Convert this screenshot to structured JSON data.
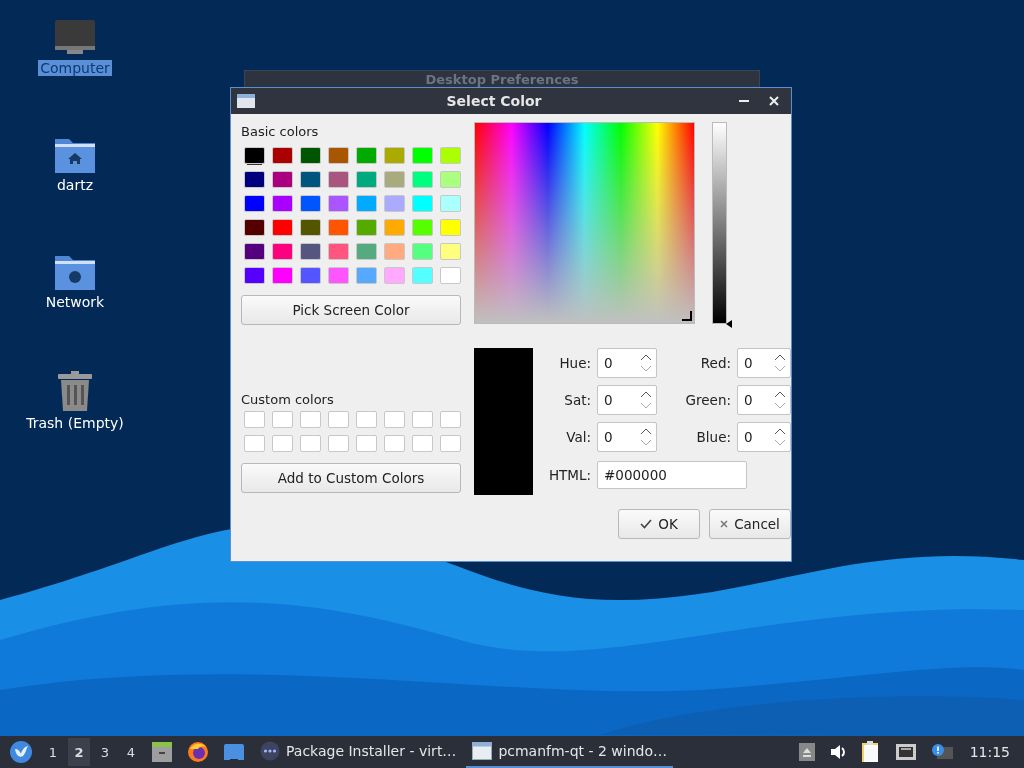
{
  "desktop_icons": [
    {
      "kind": "computer",
      "label": "Computer",
      "selected": true
    },
    {
      "kind": "home",
      "label": "dartz",
      "selected": false
    },
    {
      "kind": "network",
      "label": "Network",
      "selected": false
    },
    {
      "kind": "trash",
      "label": "Trash (Empty)",
      "selected": false
    }
  ],
  "background_window": {
    "title": "Desktop Preferences"
  },
  "dialog": {
    "title": "Select Color",
    "basic_colors_label": "Basic colors",
    "basic_colors": [
      {
        "color": "#000000",
        "selected": true
      },
      {
        "color": "#aa0000",
        "selected": false
      },
      {
        "color": "#005500",
        "selected": false
      },
      {
        "color": "#aa5500",
        "selected": false
      },
      {
        "color": "#00aa00",
        "selected": false
      },
      {
        "color": "#aaaa00",
        "selected": false
      },
      {
        "color": "#00ff00",
        "selected": false
      },
      {
        "color": "#aaff00",
        "selected": false
      },
      {
        "color": "#00007f",
        "selected": false
      },
      {
        "color": "#aa007f",
        "selected": false
      },
      {
        "color": "#00557f",
        "selected": false
      },
      {
        "color": "#aa557f",
        "selected": false
      },
      {
        "color": "#00aa7f",
        "selected": false
      },
      {
        "color": "#aaaa7f",
        "selected": false
      },
      {
        "color": "#00ff7f",
        "selected": false
      },
      {
        "color": "#aaff7f",
        "selected": false
      },
      {
        "color": "#0000ff",
        "selected": false
      },
      {
        "color": "#aa00ff",
        "selected": false
      },
      {
        "color": "#0055ff",
        "selected": false
      },
      {
        "color": "#aa55ff",
        "selected": false
      },
      {
        "color": "#00aaff",
        "selected": false
      },
      {
        "color": "#aaaaff",
        "selected": false
      },
      {
        "color": "#00ffff",
        "selected": false
      },
      {
        "color": "#aaffff",
        "selected": false
      },
      {
        "color": "#550000",
        "selected": false
      },
      {
        "color": "#ff0000",
        "selected": false
      },
      {
        "color": "#555500",
        "selected": false
      },
      {
        "color": "#ff5500",
        "selected": false
      },
      {
        "color": "#55aa00",
        "selected": false
      },
      {
        "color": "#ffaa00",
        "selected": false
      },
      {
        "color": "#55ff00",
        "selected": false
      },
      {
        "color": "#ffff00",
        "selected": false
      },
      {
        "color": "#55007f",
        "selected": false
      },
      {
        "color": "#ff007f",
        "selected": false
      },
      {
        "color": "#55557f",
        "selected": false
      },
      {
        "color": "#ff557f",
        "selected": false
      },
      {
        "color": "#55aa7f",
        "selected": false
      },
      {
        "color": "#ffaa7f",
        "selected": false
      },
      {
        "color": "#55ff7f",
        "selected": false
      },
      {
        "color": "#ffff7f",
        "selected": false
      },
      {
        "color": "#5500ff",
        "selected": false
      },
      {
        "color": "#ff00ff",
        "selected": false
      },
      {
        "color": "#5555ff",
        "selected": false
      },
      {
        "color": "#ff55ff",
        "selected": false
      },
      {
        "color": "#55aaff",
        "selected": false
      },
      {
        "color": "#ffaaff",
        "selected": false
      },
      {
        "color": "#55ffff",
        "selected": false
      },
      {
        "color": "#ffffff",
        "selected": false
      }
    ],
    "pick_button": "Pick Screen Color",
    "custom_colors_label": "Custom colors",
    "custom_colors": [
      {
        "color": "#ffffff"
      },
      {
        "color": "#ffffff"
      },
      {
        "color": "#ffffff"
      },
      {
        "color": "#ffffff"
      },
      {
        "color": "#ffffff"
      },
      {
        "color": "#ffffff"
      },
      {
        "color": "#ffffff"
      },
      {
        "color": "#ffffff"
      },
      {
        "color": "#ffffff"
      },
      {
        "color": "#ffffff"
      },
      {
        "color": "#ffffff"
      },
      {
        "color": "#ffffff"
      },
      {
        "color": "#ffffff"
      },
      {
        "color": "#ffffff"
      },
      {
        "color": "#ffffff"
      },
      {
        "color": "#ffffff"
      }
    ],
    "add_button": "Add to Custom Colors",
    "value_slider": {
      "level": 0
    },
    "preview": {
      "color": "#000000"
    },
    "spin_fields": [
      {
        "label": "Hue:",
        "value": "0"
      },
      {
        "label": "Red:",
        "value": "0"
      },
      {
        "label": "Sat:",
        "value": "0"
      },
      {
        "label": "Green:",
        "value": "0"
      },
      {
        "label": "Val:",
        "value": "0"
      },
      {
        "label": "Blue:",
        "value": "0"
      }
    ],
    "html_field": {
      "label": "HTML:",
      "value": "#000000"
    },
    "buttons": [
      {
        "kind": "ok",
        "label": "OK"
      },
      {
        "kind": "cancel",
        "label": "Cancel"
      }
    ]
  },
  "taskbar": {
    "workspaces": [
      {
        "label": "1",
        "selected": false
      },
      {
        "label": "2",
        "selected": true
      },
      {
        "label": "3",
        "selected": false
      },
      {
        "label": "4",
        "selected": false
      }
    ],
    "launchers": [
      {
        "kind": "files"
      },
      {
        "kind": "browser"
      },
      {
        "kind": "desktop"
      }
    ],
    "tasks": [
      {
        "kind": "installer",
        "label": "Package Installer - virt…",
        "selected": false
      },
      {
        "kind": "window",
        "label": "pcmanfm-qt - 2 windo…",
        "selected": true
      }
    ],
    "tray": [
      {
        "kind": "eject"
      },
      {
        "kind": "volume"
      },
      {
        "kind": "clipboard"
      },
      {
        "kind": "network"
      },
      {
        "kind": "notice"
      }
    ],
    "clock": "11:15"
  }
}
